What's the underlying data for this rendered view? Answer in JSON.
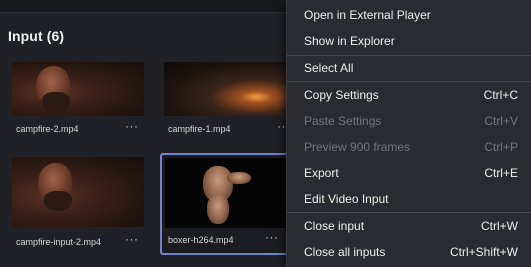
{
  "panel": {
    "title": "Input (6)"
  },
  "cards": [
    {
      "label": "campfire-2.mp4",
      "more": "···"
    },
    {
      "label": "campfire-1.mp4",
      "more": "···"
    },
    {
      "label": "campfire-input-2.mp4",
      "more": "···"
    },
    {
      "label": "boxer-h264.mp4",
      "more": "···"
    }
  ],
  "menu": {
    "items": [
      {
        "label": "Open in External Player",
        "shortcut": "",
        "enabled": true
      },
      {
        "label": "Show in Explorer",
        "shortcut": "",
        "enabled": true
      },
      {
        "label": "Select All",
        "shortcut": "",
        "enabled": true
      },
      {
        "label": "Copy Settings",
        "shortcut": "Ctrl+C",
        "enabled": true
      },
      {
        "label": "Paste Settings",
        "shortcut": "Ctrl+V",
        "enabled": false
      },
      {
        "label": "Preview 900 frames",
        "shortcut": "Ctrl+P",
        "enabled": false
      },
      {
        "label": "Export",
        "shortcut": "Ctrl+E",
        "enabled": true
      },
      {
        "label": "Edit Video Input",
        "shortcut": "",
        "enabled": true
      },
      {
        "label": "Close input",
        "shortcut": "Ctrl+W",
        "enabled": true
      },
      {
        "label": "Close all inputs",
        "shortcut": "Ctrl+Shift+W",
        "enabled": true
      }
    ]
  }
}
